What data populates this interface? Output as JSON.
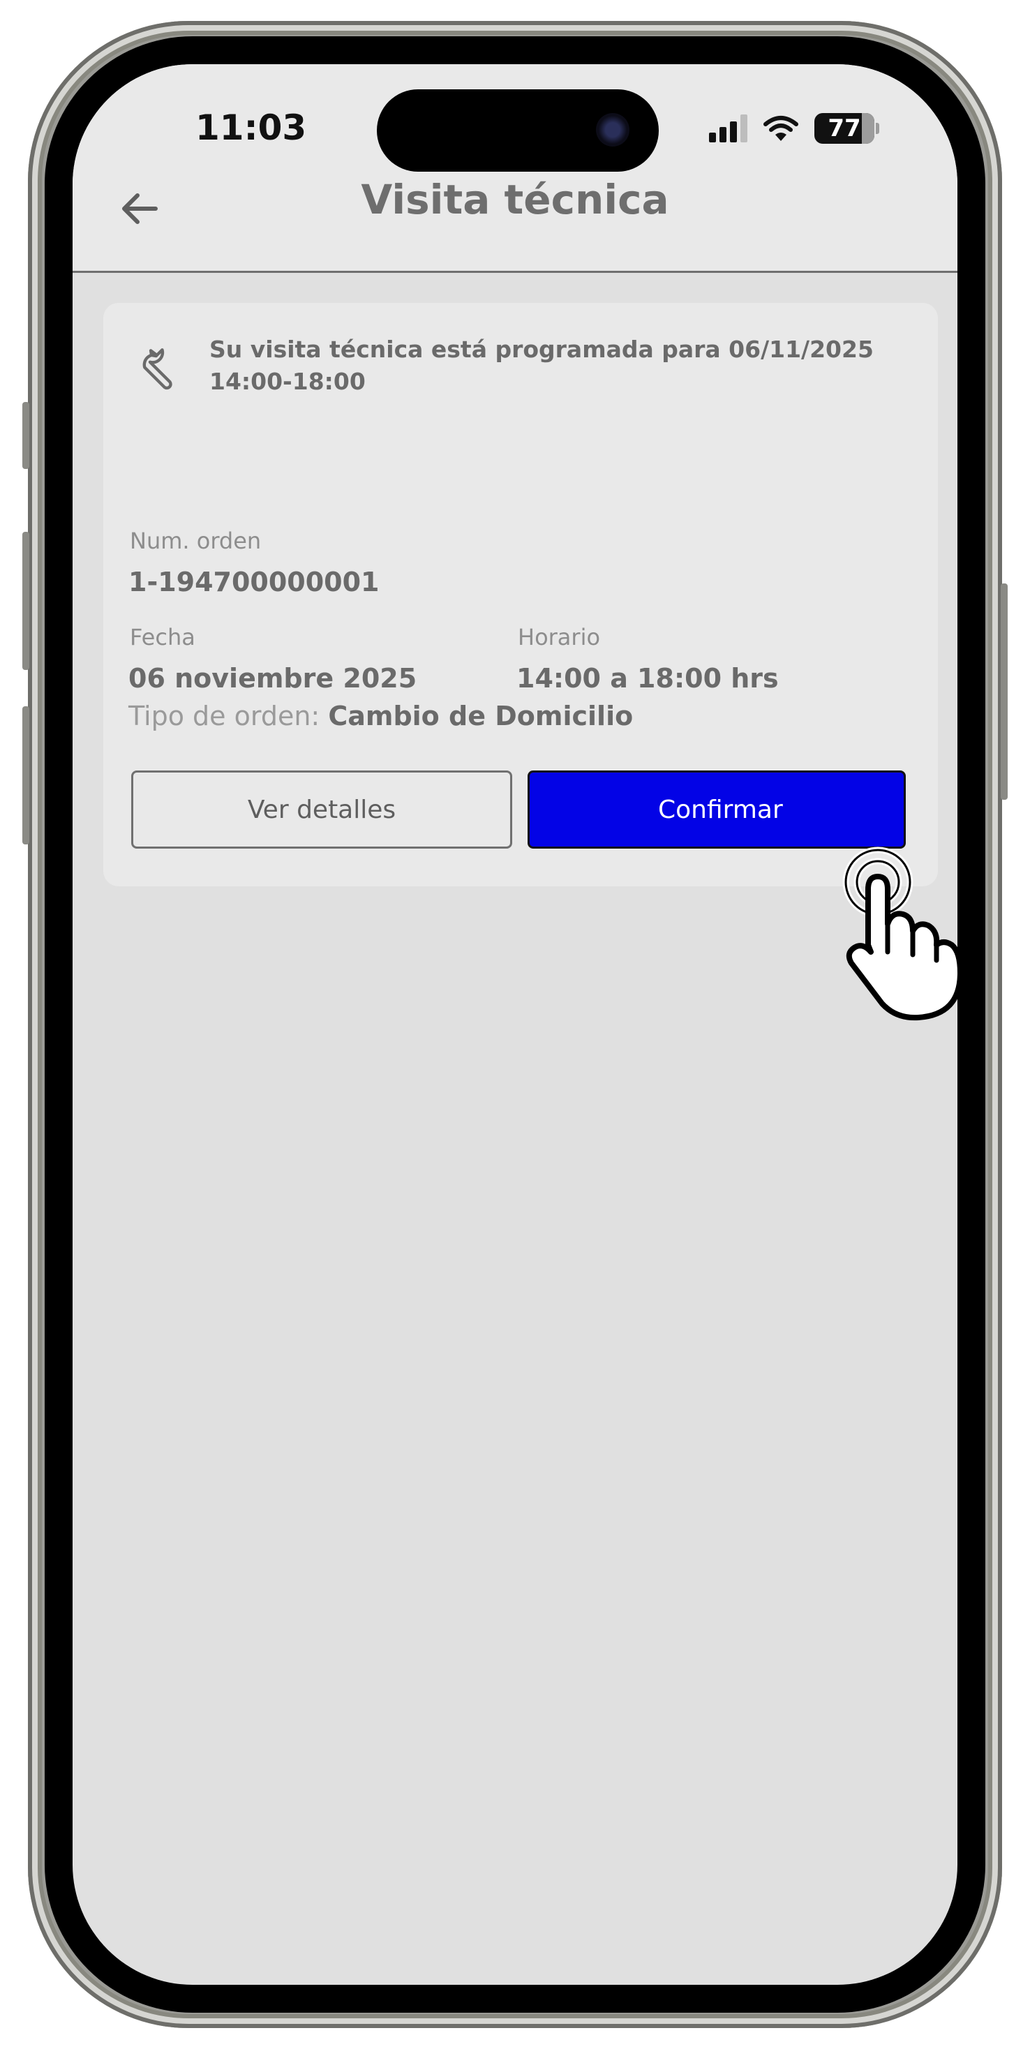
{
  "status_bar": {
    "time": "11:03",
    "battery": "77"
  },
  "header": {
    "title": "Visita técnica"
  },
  "card": {
    "alert_text": "Su visita técnica está programada para 06/11/2025 14:00-18:00",
    "order_label": "Num. orden",
    "order_value": "1-194700000001",
    "date_label": "Fecha",
    "date_value": "06 noviembre 2025",
    "time_label": "Horario",
    "time_value": "14:00 a 18:00 hrs",
    "type_label": "Tipo de orden:",
    "type_value": "Cambio de Domicilio",
    "details_button": "Ver detalles",
    "confirm_button": "Confirmar"
  },
  "colors": {
    "primary": "#0303e6",
    "background": "#e0e0e0",
    "card": "#e9e9e9"
  },
  "icons": [
    "back-arrow-icon",
    "wrench-icon",
    "signal-icon",
    "wifi-icon",
    "battery-icon",
    "tap-hand-icon"
  ]
}
